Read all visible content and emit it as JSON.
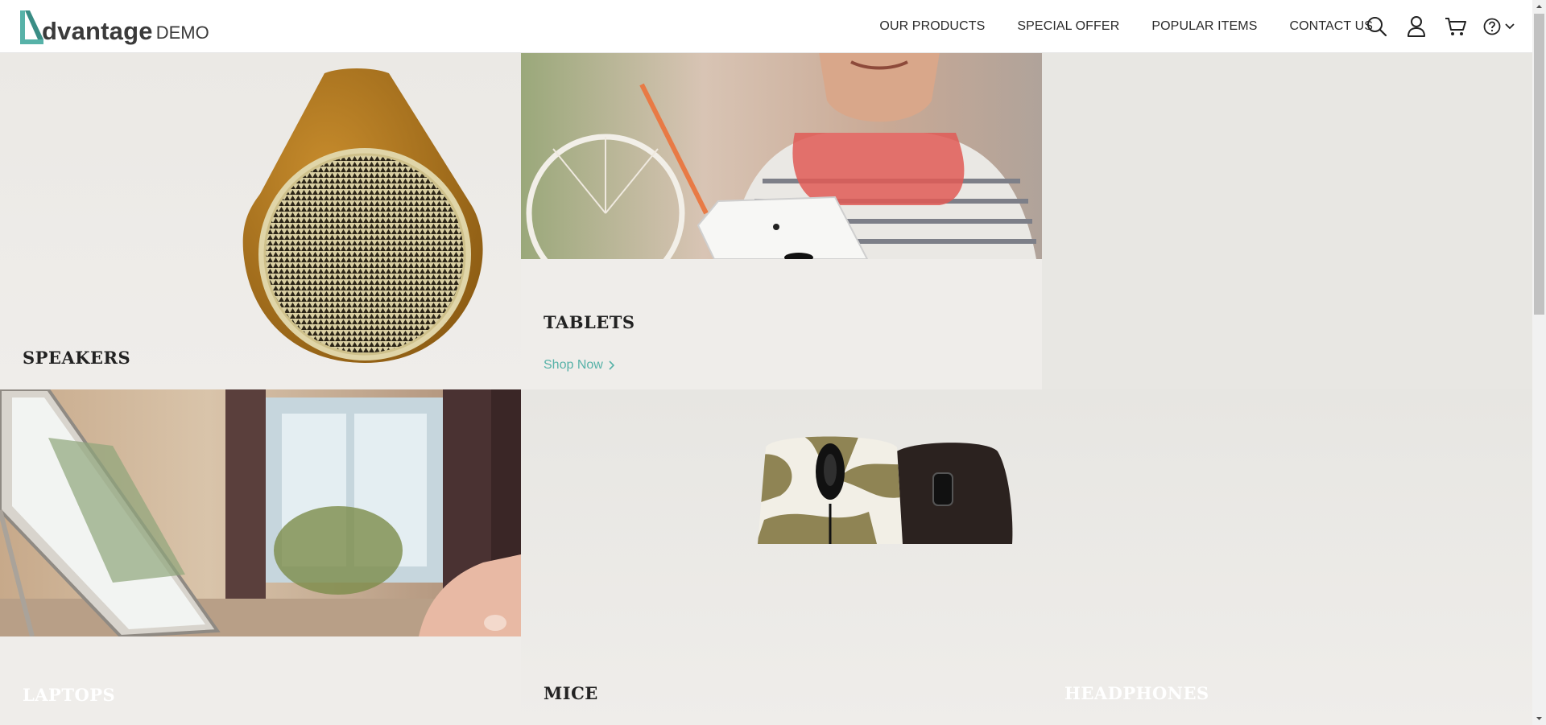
{
  "header": {
    "logo": {
      "main": "dvantage",
      "sub": "DEMO"
    },
    "nav": [
      "OUR PRODUCTS",
      "SPECIAL OFFER",
      "POPULAR ITEMS",
      "CONTACT US"
    ],
    "icons": [
      "search-icon",
      "user-icon",
      "cart-icon",
      "help-icon",
      "chevron-down-icon"
    ]
  },
  "categories": {
    "speakers": {
      "title": "SPEAKERS"
    },
    "tablets": {
      "title": "TABLETS",
      "link": "Shop Now"
    },
    "laptops": {
      "title": "LAPTOPS"
    },
    "mice": {
      "title": "MICE"
    },
    "headphones": {
      "title": "HEADPHONES"
    }
  },
  "colors": {
    "accent": "#57b2a8",
    "logo_mark": "#57b2a8",
    "text": "#222222",
    "background": "#ecebe7"
  }
}
